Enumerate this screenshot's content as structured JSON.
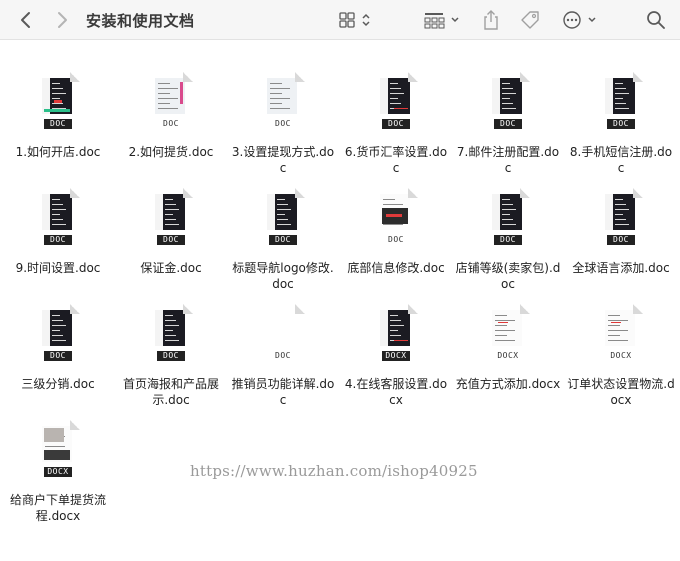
{
  "window": {
    "title": "安装和使用文档"
  },
  "toolbar": {
    "back_icon": "chevron-left-icon",
    "forward_icon": "chevron-right-icon",
    "view_icon": "grid-view-icon",
    "group_icon": "group-icon",
    "share_icon": "share-icon",
    "tag_icon": "tag-icon",
    "more_icon": "ellipsis-circle-icon",
    "search_icon": "search-icon"
  },
  "files": [
    {
      "name": "1.如何开店.doc",
      "badge": "DOC",
      "style": "dark-green"
    },
    {
      "name": "2.如何提货.doc",
      "badge": "DOC",
      "style": "light-pink"
    },
    {
      "name": "3.设置提现方式.doc",
      "badge": "DOC",
      "style": "light"
    },
    {
      "name": "6.货币汇率设置.doc",
      "badge": "DOC",
      "style": "dark-red"
    },
    {
      "name": "7.邮件注册配置.doc",
      "badge": "DOC",
      "style": "dark"
    },
    {
      "name": "8.手机短信注册.doc",
      "badge": "DOC",
      "style": "dark"
    },
    {
      "name": "9.时间设置.doc",
      "badge": "DOC",
      "style": "dark"
    },
    {
      "name": "保证金.doc",
      "badge": "DOC",
      "style": "dark"
    },
    {
      "name": "标题导航logo修改.doc",
      "badge": "DOC",
      "style": "dark"
    },
    {
      "name": "底部信息修改.doc",
      "badge": "DOC",
      "style": "white-dark"
    },
    {
      "name": "店铺等级(卖家包).doc",
      "badge": "DOC",
      "style": "dark"
    },
    {
      "name": "全球语言添加.doc",
      "badge": "DOC",
      "style": "dark"
    },
    {
      "name": "三级分销.doc",
      "badge": "DOC",
      "style": "dark"
    },
    {
      "name": "首页海报和产品展示.doc",
      "badge": "DOC",
      "style": "dark"
    },
    {
      "name": "推销员功能详解.doc",
      "badge": "DOC",
      "style": "blank"
    },
    {
      "name": "4.在线客服设置.docx",
      "badge": "DOCX",
      "style": "dark-red"
    },
    {
      "name": "充值方式添加.docx",
      "badge": "DOCX",
      "style": "white"
    },
    {
      "name": "订单状态设置物流.docx",
      "badge": "DOCX",
      "style": "white"
    },
    {
      "name": "给商户下单提货流程.docx",
      "badge": "DOCX",
      "style": "grey"
    }
  ],
  "watermark": "https://www.huzhan.com/ishop40925"
}
